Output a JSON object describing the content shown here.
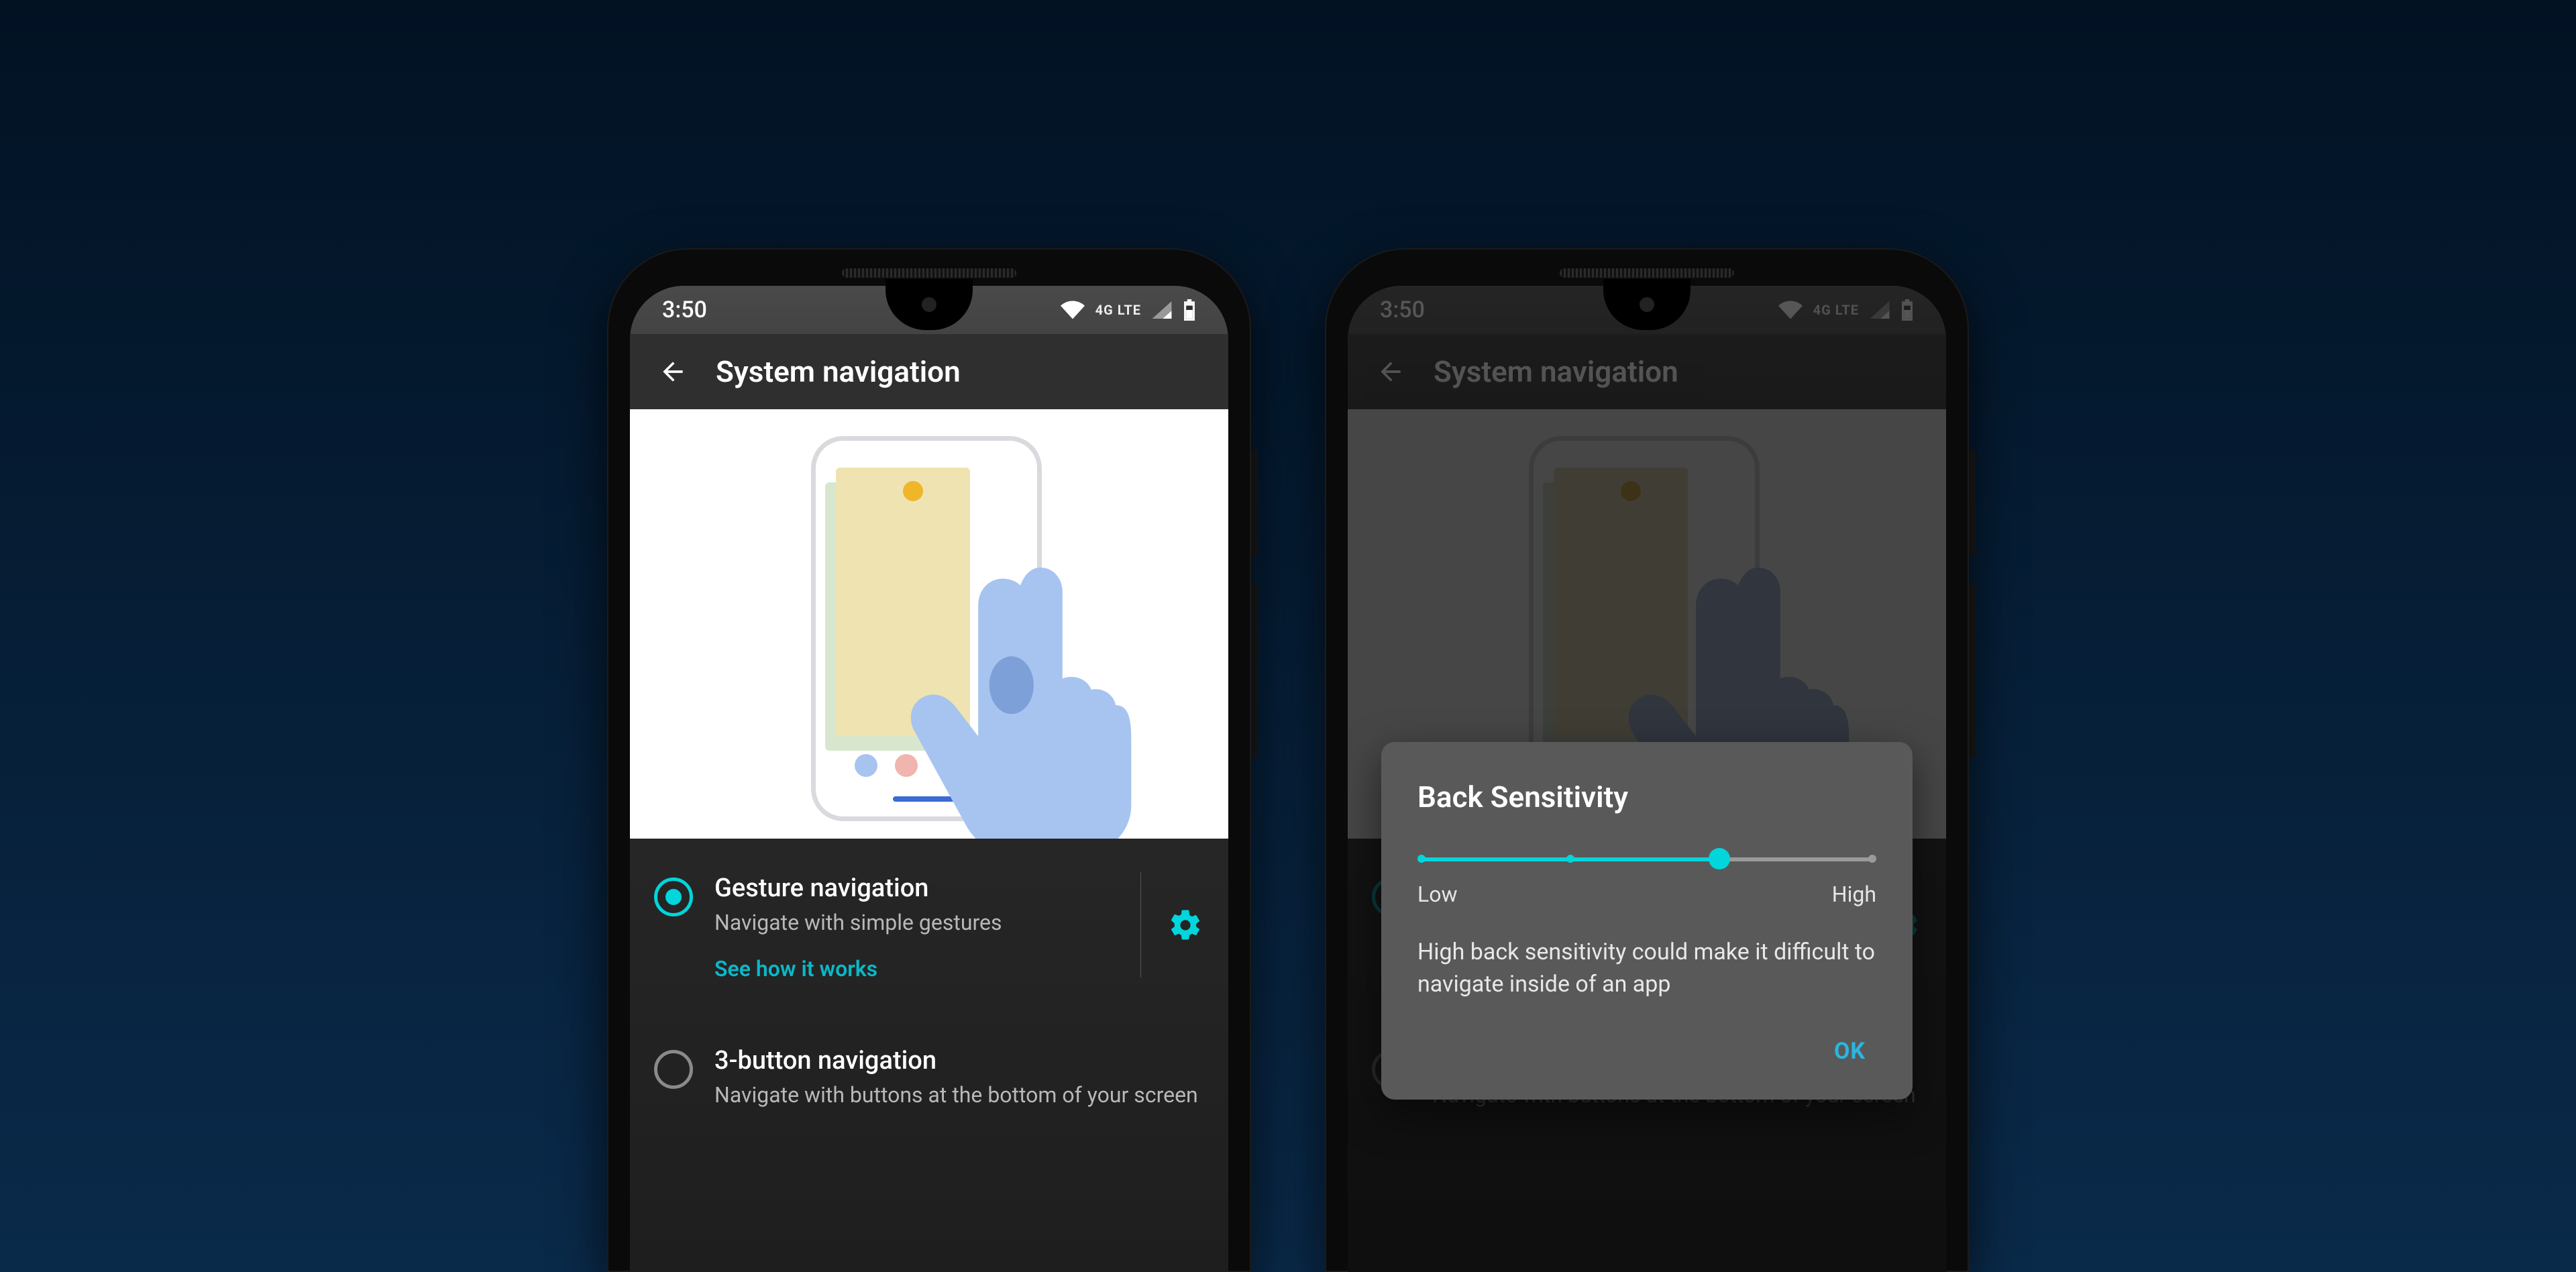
{
  "status": {
    "time": "3:50",
    "network_label": "4G LTE"
  },
  "appbar": {
    "title": "System navigation"
  },
  "options": {
    "gesture": {
      "title": "Gesture navigation",
      "subtitle": "Navigate with simple gestures",
      "link": "See how it works"
    },
    "three_button": {
      "title": "3-button navigation",
      "subtitle": "Navigate with buttons at the bottom of your screen"
    }
  },
  "dialog": {
    "title": "Back Sensitivity",
    "low": "Low",
    "high": "High",
    "message": "High back sensitivity could make it difficult to navigate inside of an app",
    "ok": "OK"
  }
}
